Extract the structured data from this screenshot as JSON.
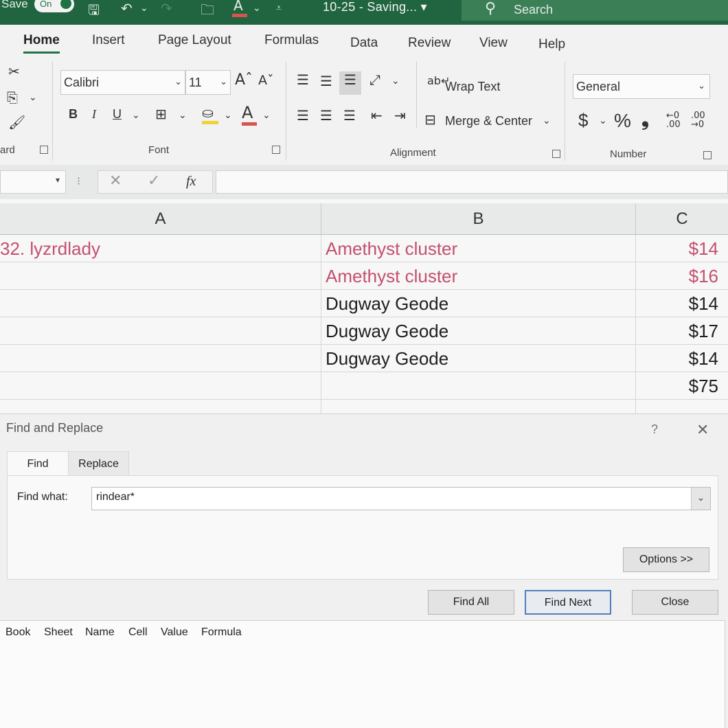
{
  "titlebar": {
    "autosave_label": "Save",
    "toggle_label": "On",
    "doc_title": "10-25  -  Saving...  ▾",
    "search_placeholder": "Search"
  },
  "ribbon": {
    "tabs": [
      "Home",
      "Insert",
      "Page Layout",
      "Formulas",
      "Data",
      "Review",
      "View",
      "Help"
    ],
    "clipboard_label": "ard",
    "font": {
      "name": "Calibri",
      "size": "11",
      "bold": "B",
      "italic": "I",
      "underline": "U",
      "group_label": "Font"
    },
    "alignment": {
      "wrap_text": "Wrap Text",
      "merge_center": "Merge & Center",
      "group_label": "Alignment"
    },
    "number": {
      "format": "General",
      "currency": "$",
      "percent": "%",
      "comma": "❟",
      "group_label": "Number"
    }
  },
  "formula_bar": {
    "fx_label": "fx",
    "value": ""
  },
  "grid": {
    "columns": [
      "A",
      "B",
      "C"
    ],
    "rows": [
      {
        "a": "32. lyzrdlady",
        "b": "Amethyst cluster",
        "c": "$14",
        "style": "pink"
      },
      {
        "a": "",
        "b": "Amethyst cluster",
        "c": "$16",
        "style": "pink"
      },
      {
        "a": "",
        "b": "Dugway Geode",
        "c": "$14",
        "style": "black"
      },
      {
        "a": "",
        "b": "Dugway Geode",
        "c": "$17",
        "style": "black"
      },
      {
        "a": "",
        "b": "Dugway Geode",
        "c": "$14",
        "style": "black"
      },
      {
        "a": "",
        "b": "",
        "c": "$75",
        "style": "black"
      }
    ]
  },
  "dialog": {
    "title": "Find and Replace",
    "help": "?",
    "close": "✕",
    "tabs": {
      "find": "Find",
      "replace": "Replace"
    },
    "find_what_label": "Find what:",
    "find_what_value": "rindear*",
    "options_label": "Options >>",
    "find_all_label": "Find All",
    "find_next_label": "Find Next",
    "close_label": "Close",
    "result_columns": [
      "Book",
      "Sheet",
      "Name",
      "Cell",
      "Value",
      "Formula"
    ]
  },
  "colors": {
    "excel_green": "#20653f",
    "pink_text": "#c4506f",
    "focus_blue": "#4f7fbf"
  }
}
